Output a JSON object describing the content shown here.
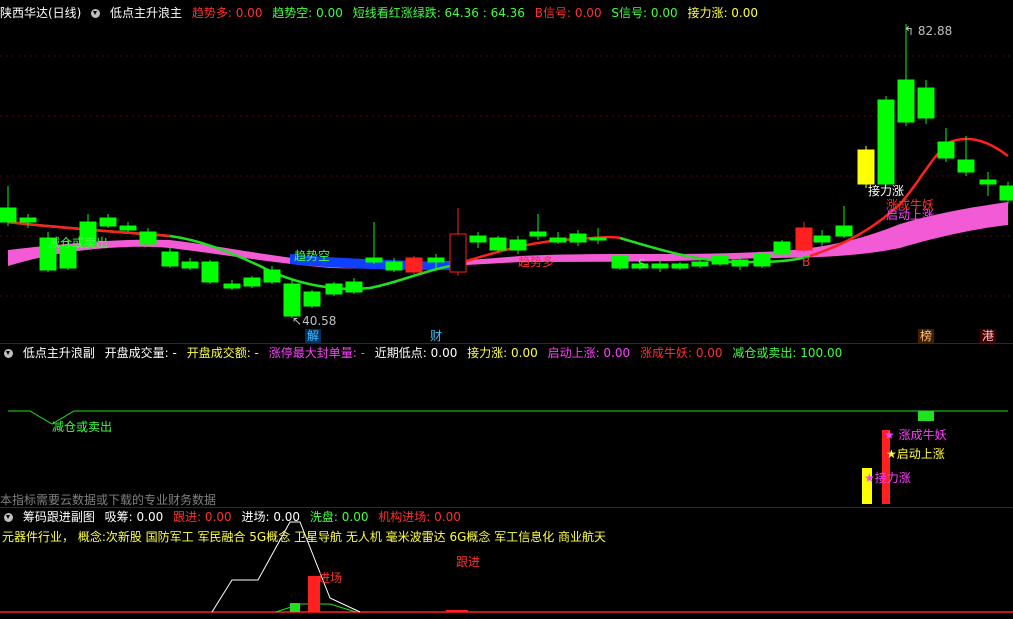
{
  "main": {
    "stock": "陕西华达(日线)",
    "indicator": "低点主升浪主",
    "items": [
      {
        "text": "趋势多: 0.00",
        "color": "#ff3030"
      },
      {
        "text": "趋势空: 0.00",
        "color": "#40ff40"
      },
      {
        "text": "短线看红涨绿跌: 64.36 : 64.36",
        "color": "#40ff40"
      },
      {
        "text": "B信号: 0.00",
        "color": "#ff3030"
      },
      {
        "text": "S信号: 0.00",
        "color": "#40ff40"
      },
      {
        "text": "接力涨: 0.00",
        "color": "#ffff40"
      }
    ],
    "high_label": "82.88",
    "low_label": "40.58",
    "annotations": {
      "qsk": "趋势空",
      "qsd": "趋势多",
      "jlz": "接力涨",
      "zcny": "涨成牛妖",
      "qdsz": "启动上涨",
      "jcm": "减仓或卖出",
      "b_sig": "B",
      "s_sig": "S"
    },
    "bottom_tags": {
      "jie": "解",
      "cai": "财",
      "bang": "榜",
      "gang": "港"
    }
  },
  "sub1": {
    "indicator": "低点主升浪副",
    "items": [
      {
        "text": "开盘成交量: -",
        "color": "#ffffff"
      },
      {
        "text": "开盘成交额: -",
        "color": "#ffff40"
      },
      {
        "text": "涨停最大封单量: -",
        "color": "#ff40ff"
      },
      {
        "text": "近期低点: 0.00",
        "color": "#ffffff"
      },
      {
        "text": "接力涨: 0.00",
        "color": "#ffff40"
      },
      {
        "text": "启动上涨: 0.00",
        "color": "#ff40ff"
      },
      {
        "text": "涨成牛妖: 0.00",
        "color": "#ff3030"
      },
      {
        "text": "减仓或卖出: 100.00",
        "color": "#40ff40"
      }
    ],
    "labels": {
      "jcm": "减仓或卖出",
      "zcny": "★ 涨成牛妖",
      "qdsz": "★启动上涨",
      "jlz": "★接力涨"
    },
    "notice": "本指标需要云数据或下载的专业财务数据"
  },
  "sub2": {
    "indicator": "筹码跟进副图",
    "items": [
      {
        "text": "吸筹: 0.00",
        "color": "#ffffff"
      },
      {
        "text": "跟进: 0.00",
        "color": "#ff3030"
      },
      {
        "text": "进场: 0.00",
        "color": "#ffffff"
      },
      {
        "text": "洗盘: 0.00",
        "color": "#40ff40"
      },
      {
        "text": "机构进场: 0.00",
        "color": "#ff3030"
      }
    ],
    "concept": "元器件行业， 概念:次新股 国防军工 军民融合 5G概念 卫星导航 无人机 毫米波雷达 6G概念 军工信息化 商业航天",
    "gen_jin": "跟进",
    "jin_chang": "进场"
  },
  "colors": {
    "up": "#ff2020",
    "down": "#00ff00",
    "yellow": "#ffff00",
    "pink": "#ff60e0",
    "blue": "#1040ff"
  }
}
